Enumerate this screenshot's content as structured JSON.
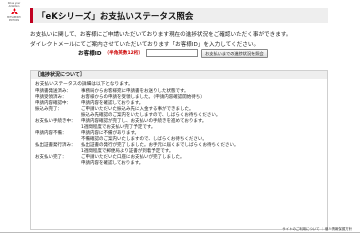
{
  "brand": {
    "tagline": "Drive your Ambition",
    "name": "MITSUBISHI MOTORS"
  },
  "page": {
    "title": "「eKシリーズ」お支払いステータス照会"
  },
  "intro": {
    "line1": "お支払いに関して、お客様にご申請いただいております現在の進捗状況をご確認いただく事ができます。",
    "line2": "ダイレクトメールにてご案内させていただいております「お客様ID」を入力してください。"
  },
  "form": {
    "label": "お客様ID",
    "note": "（半角英数12桁）",
    "input_value": "",
    "input_placeholder": "",
    "button_label": "お支払いまでの進捗状況を照会"
  },
  "status_box": {
    "header": "［進捗状況について］",
    "intro": "お支払いステータスの詳細は以下となります。",
    "items": [
      {
        "term": "申請書発送済み：",
        "lines": [
          "事務局からお客様宛に申請書をお送りした状態です。"
        ]
      },
      {
        "term": "申請受領済み：",
        "lines": [
          "お客様からの申請を受領しました。（申請内容確認開始待ち）"
        ]
      },
      {
        "term": "申請内容確認中：",
        "lines": [
          "申請内容を確認しております。"
        ]
      },
      {
        "term": "振込み完了：",
        "lines": [
          "ご申請いただいた振込み先に入金する事ができました。",
          "振込み先確認のご案内をいたしますので、しばらくお待ちください。"
        ]
      },
      {
        "term": "お支払い手続き中：",
        "lines": [
          "申請内容確認が完了し、お支払いの手続きを進めております。",
          "1週間程度でお支払い完了予定です。"
        ]
      },
      {
        "term": "申請内容不備：",
        "lines": [
          "申請内容に不備があります。",
          "不備確認のご案内いたしますので、しばらくお待ちください。"
        ]
      },
      {
        "term": "払出証書発行済み：",
        "lines": [
          "払出証書の発行が完了しました。お手元に届くまでしばらくお待ちください。",
          "1週間程度で郵便局より証書が到着予定です。"
        ]
      },
      {
        "term": "お支払い完了：",
        "lines": [
          "ご申請いただいた口座にお支払いが完了しました。",
          "申請内容を確認しております。"
        ]
      }
    ]
  },
  "footer": {
    "link1": "サイトのご利用について",
    "separator": "｜",
    "link2": "個人情報保護方針"
  }
}
